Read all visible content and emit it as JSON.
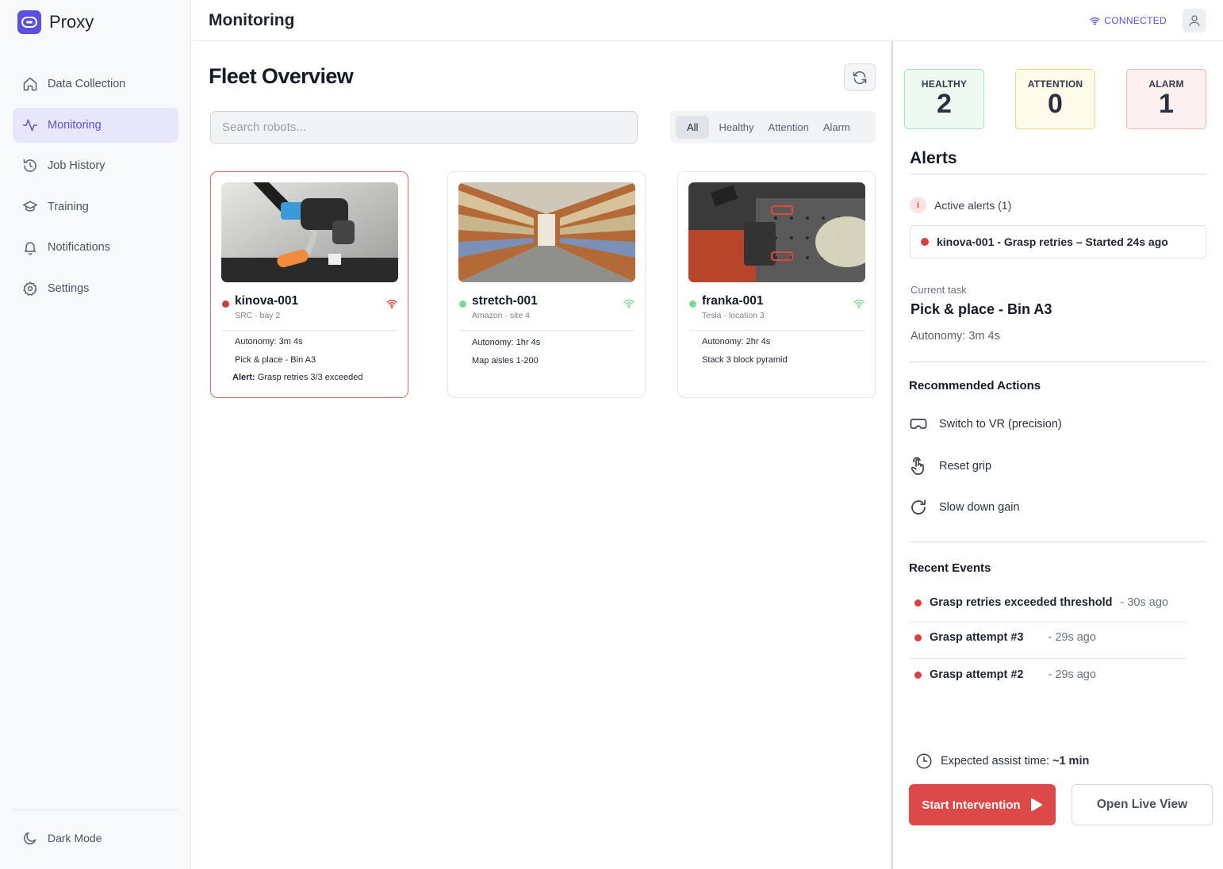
{
  "brand": {
    "name": "Proxy"
  },
  "sidebar": {
    "items": [
      {
        "label": "Data Collection",
        "icon": "home-icon"
      },
      {
        "label": "Monitoring",
        "icon": "activity-icon",
        "active": true
      },
      {
        "label": "Job History",
        "icon": "history-icon"
      },
      {
        "label": "Training",
        "icon": "graduation-cap-icon"
      },
      {
        "label": "Notifications",
        "icon": "bell-icon"
      },
      {
        "label": "Settings",
        "icon": "gear-icon"
      }
    ],
    "dark_mode_label": "Dark Mode"
  },
  "header": {
    "title": "Monitoring",
    "connection_status": "CONNECTED"
  },
  "main": {
    "title": "Fleet Overview",
    "search_placeholder": "Search robots...",
    "filters": [
      "All",
      "Healthy",
      "Attention",
      "Alarm"
    ],
    "active_filter": "All",
    "robots": [
      {
        "name": "kinova-001",
        "location": "SRC · bay 2",
        "status": "alarm",
        "autonomy": "Autonomy: 3m 4s",
        "task": "Pick & place - Bin A3",
        "alert_label": "Alert:",
        "alert_text": "Grasp retries 3/3 exceeded"
      },
      {
        "name": "stretch-001",
        "location": "Amazon · site 4",
        "status": "healthy",
        "autonomy": "Autonomy: 1hr 4s",
        "task": "Map aisles 1-200"
      },
      {
        "name": "franka-001",
        "location": "Tesla · location 3",
        "status": "healthy",
        "autonomy": "Autonomy: 2hr 4s",
        "task": "Stack 3 block pyramid"
      }
    ]
  },
  "panel": {
    "stats": {
      "healthy": {
        "label": "HEALTHY",
        "value": "2"
      },
      "attention": {
        "label": "ATTENTION",
        "value": "0"
      },
      "alarm": {
        "label": "ALARM",
        "value": "1"
      }
    },
    "alerts_title": "Alerts",
    "active_alerts_label": "Active alerts (1)",
    "active_alert": "kinova-001 - Grasp retries – Started 24s ago",
    "current_task_label": "Current task",
    "current_task": "Pick & place - Bin A3",
    "autonomy": "Autonomy: 3m 4s",
    "recommended_title": "Recommended Actions",
    "actions": [
      {
        "label": "Switch to VR (precision)",
        "icon": "vr-headset-icon"
      },
      {
        "label": "Reset grip",
        "icon": "hand-pointer-icon"
      },
      {
        "label": "Slow down gain",
        "icon": "rotate-icon"
      }
    ],
    "events_title": "Recent Events",
    "events": [
      {
        "text": "Grasp retries exceeded threshold",
        "ago": "- 30s ago"
      },
      {
        "text": "Grasp attempt #3",
        "ago": "- 29s ago"
      },
      {
        "text": "Grasp attempt #2",
        "ago": "- 29s ago"
      }
    ],
    "assist_label": "Expected assist time:",
    "assist_value": "~1 min",
    "start_button": "Start Intervention",
    "live_button": "Open Live View"
  },
  "colors": {
    "accent": "#5b4fe0",
    "alarm": "#dd4848",
    "healthy": "#7fd695"
  }
}
